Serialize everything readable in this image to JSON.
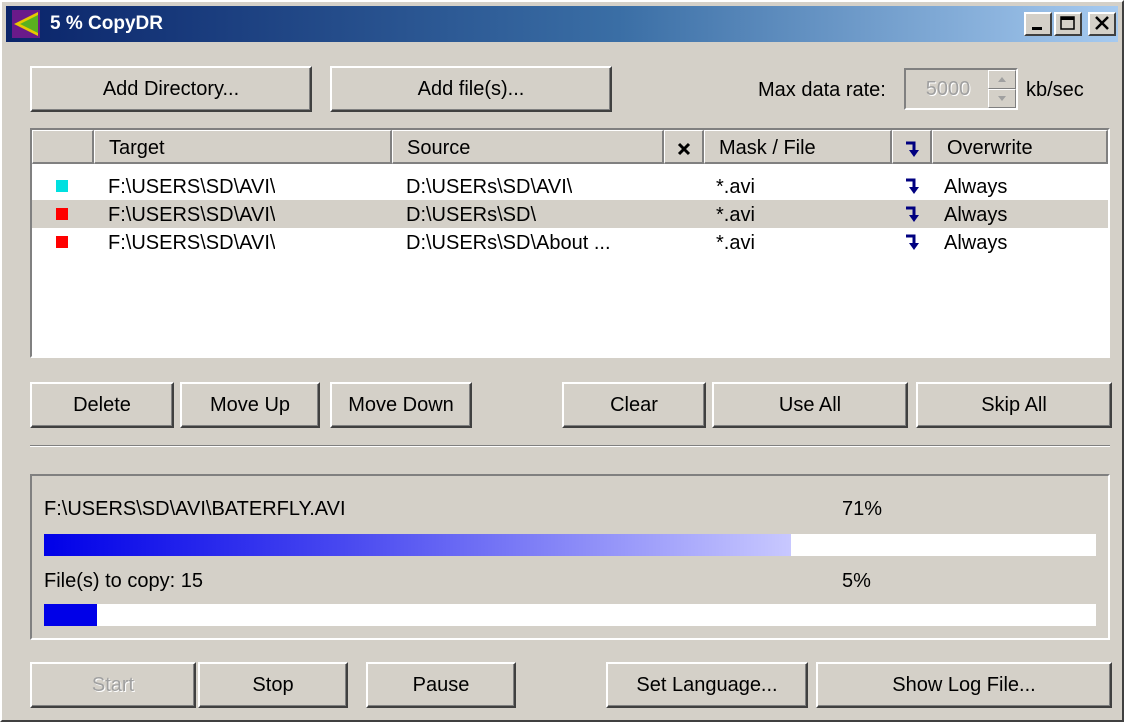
{
  "window": {
    "title": "5 % CopyDR",
    "minimize_label": "_",
    "maximize_label": "□",
    "close_label": "✕"
  },
  "toolbar": {
    "add_directory_label": "Add Directory...",
    "add_files_label": "Add file(s)...",
    "max_rate_label": "Max data rate:",
    "max_rate_value": "5000",
    "max_rate_unit": "kb/sec"
  },
  "table": {
    "headers": {
      "target": "Target",
      "source": "Source",
      "exclude_icon": "x-icon",
      "mask": "Mask / File",
      "subdir_icon": "arrow-down-right-icon",
      "overwrite": "Overwrite"
    },
    "rows": [
      {
        "status_color": "#00e0e0",
        "target": "F:\\USERS\\SD\\AVI\\",
        "source": "D:\\USERs\\SD\\AVI\\",
        "mask": "*.avi",
        "overwrite": "Always",
        "selected": false
      },
      {
        "status_color": "#ff0000",
        "target": "F:\\USERS\\SD\\AVI\\",
        "source": "D:\\USERs\\SD\\",
        "mask": "*.avi",
        "overwrite": "Always",
        "selected": true
      },
      {
        "status_color": "#ff0000",
        "target": "F:\\USERS\\SD\\AVI\\",
        "source": "D:\\USERs\\SD\\About ...",
        "mask": "*.avi",
        "overwrite": "Always",
        "selected": false
      }
    ]
  },
  "list_actions": {
    "delete_label": "Delete",
    "move_up_label": "Move Up",
    "move_down_label": "Move Down",
    "clear_label": "Clear",
    "use_all_label": "Use All",
    "skip_all_label": "Skip All"
  },
  "progress": {
    "current_file": "F:\\USERS\\SD\\AVI\\BATERFLY.AVI",
    "current_percent_text": "71%",
    "current_fraction": 0.71,
    "files_label": "File(s) to copy: 15",
    "total_percent_text": "5%",
    "total_fraction": 0.05
  },
  "bottom_actions": {
    "start_label": "Start",
    "stop_label": "Stop",
    "pause_label": "Pause",
    "set_language_label": "Set Language...",
    "show_log_label": "Show Log File..."
  },
  "colors": {
    "progress": "#0000e8",
    "titlebar_start": "#0a246a",
    "titlebar_end": "#a6caf0",
    "face": "#d4d0c8"
  }
}
